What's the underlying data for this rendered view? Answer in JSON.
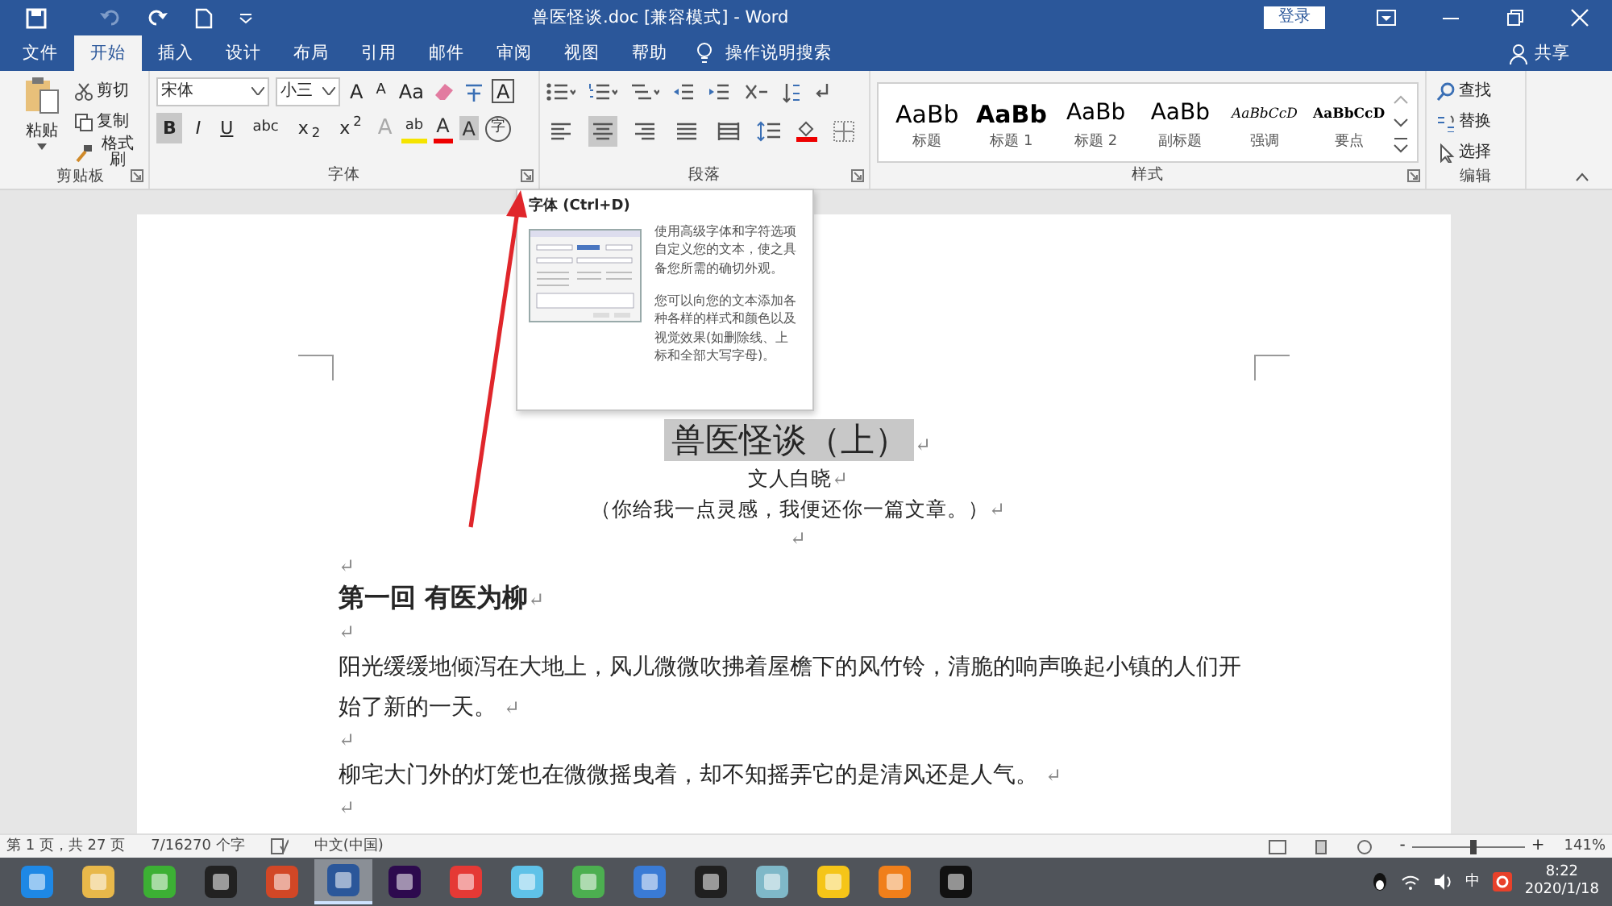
{
  "window": {
    "title": "兽医怪谈.doc [兼容模式] - Word",
    "sign_in": "登录"
  },
  "tabs": [
    {
      "label": "文件",
      "selected": false
    },
    {
      "label": "开始",
      "selected": true
    },
    {
      "label": "插入",
      "selected": false
    },
    {
      "label": "设计",
      "selected": false
    },
    {
      "label": "布局",
      "selected": false
    },
    {
      "label": "引用",
      "selected": false
    },
    {
      "label": "邮件",
      "selected": false
    },
    {
      "label": "审阅",
      "selected": false
    },
    {
      "label": "视图",
      "selected": false
    },
    {
      "label": "帮助",
      "selected": false
    }
  ],
  "tell_me": "操作说明搜索",
  "share": "共享",
  "ribbon": {
    "clipboard": {
      "paste": "粘贴",
      "items": [
        "剪切",
        "复制",
        "格式刷"
      ],
      "label": "剪贴板"
    },
    "font": {
      "name": "宋体",
      "size": "小三",
      "label": "字体",
      "tools": [
        {
          "kind": "grow",
          "label": "A"
        },
        {
          "kind": "shrink",
          "label": "A"
        },
        {
          "kind": "case",
          "label": "Aa"
        },
        {
          "kind": "border",
          "label": "A"
        }
      ],
      "formats": [
        {
          "label": "B",
          "selected": true
        },
        {
          "label": "I",
          "selected": false
        },
        {
          "label": "U",
          "selected": false
        },
        {
          "label": "abc",
          "selected": false
        },
        {
          "label": "x$_{2}$",
          "selected": false
        },
        {
          "label": "x$^{2}$",
          "selected": false
        }
      ],
      "effects": [
        {
          "kind": "effect",
          "label": "A"
        },
        {
          "kind": "highlight",
          "label": "ab"
        },
        {
          "kind": "color",
          "label": "A"
        },
        {
          "kind": "shading",
          "label": "A"
        },
        {
          "kind": "enclose",
          "label": "字"
        }
      ]
    },
    "paragraph": {
      "label": "段落",
      "alignments": [
        {
          "kind": "left",
          "selected": false
        },
        {
          "kind": "center",
          "selected": true
        },
        {
          "kind": "right",
          "selected": false
        },
        {
          "kind": "justify",
          "selected": false
        },
        {
          "kind": "distributed",
          "selected": false
        }
      ]
    },
    "styles": {
      "label": "样式",
      "items": [
        {
          "preview": "AaBb",
          "name": "标题",
          "kind": "title"
        },
        {
          "preview": "AaBb",
          "name": "标题 1",
          "kind": "heading1"
        },
        {
          "preview": "AaBb",
          "name": "标题 2",
          "kind": "heading2"
        },
        {
          "preview": "AaBb",
          "name": "副标题",
          "kind": "subtitle"
        },
        {
          "preview": "AaBbCcD",
          "name": "强调",
          "kind": "emphasis"
        },
        {
          "preview": "AaBbCcD",
          "name": "要点",
          "kind": "strong"
        }
      ]
    },
    "editing": {
      "label": "编辑",
      "items": [
        "查找",
        "替换",
        "选择"
      ]
    }
  },
  "tooltip": {
    "title": "字体 (Ctrl+D)",
    "paragraphs": [
      "使用高级字体和字符选项自定义您的文本，使之具备您所需的确切外观。",
      "您可以向您的文本添加各种各样的样式和颜色以及视觉效果(如删除线、上标和全部大写字母)。"
    ]
  },
  "document": {
    "paragraph_mark": "↵",
    "paragraphs": [
      {
        "kind": "title",
        "text": "兽医怪谈（上）",
        "selected": true
      },
      {
        "kind": "center",
        "text": "文人白晓"
      },
      {
        "kind": "center",
        "text": "（你给我一点灵感，我便还你一篇文章。）"
      },
      {
        "kind": "center_empty"
      },
      {
        "kind": "empty"
      },
      {
        "kind": "heading",
        "text": "第一回  有医为柳"
      },
      {
        "kind": "empty"
      },
      {
        "kind": "body",
        "text": "阳光缓缓地倾泻在大地上，风儿微微吹拂着屋檐下的风竹铃，清脆的响声唤起小镇的人们开始了新的一天。"
      },
      {
        "kind": "empty"
      },
      {
        "kind": "body",
        "text": "柳宅大门外的灯笼也在微微摇曳着，却不知摇弄它的是清风还是人气。"
      },
      {
        "kind": "empty"
      }
    ]
  },
  "status_bar": {
    "page": "第 1 页，共 27 页",
    "words": "7/16270 个字",
    "language": "中文(中国)",
    "zoom_out": "-",
    "zoom_in": "+",
    "zoom": "141%",
    "zoom_slider": {
      "level": 0.55
    }
  },
  "taskbar": {
    "apps": [
      {
        "color": "#1e88e5",
        "selected": false
      },
      {
        "color": "#e8b84a",
        "selected": false
      },
      {
        "color": "#3cb034",
        "selected": false
      },
      {
        "color": "#222222",
        "selected": false
      },
      {
        "color": "#d24726",
        "selected": false
      },
      {
        "color": "#2b579a",
        "selected": true
      },
      {
        "color": "#2d0a4e",
        "selected": false
      },
      {
        "color": "#e53935",
        "selected": false
      },
      {
        "color": "#5fc2e8",
        "selected": false
      },
      {
        "color": "#4caf50",
        "selected": false
      },
      {
        "color": "#3a7bd5",
        "selected": false
      },
      {
        "color": "#202020",
        "selected": false
      },
      {
        "color": "#7fb8c8",
        "selected": false
      },
      {
        "color": "#f5c518",
        "selected": false
      },
      {
        "color": "#f07f1a",
        "selected": false
      },
      {
        "color": "#111111",
        "selected": false
      }
    ],
    "ime": "中",
    "time": "8:22",
    "date": "2020/1/18"
  }
}
